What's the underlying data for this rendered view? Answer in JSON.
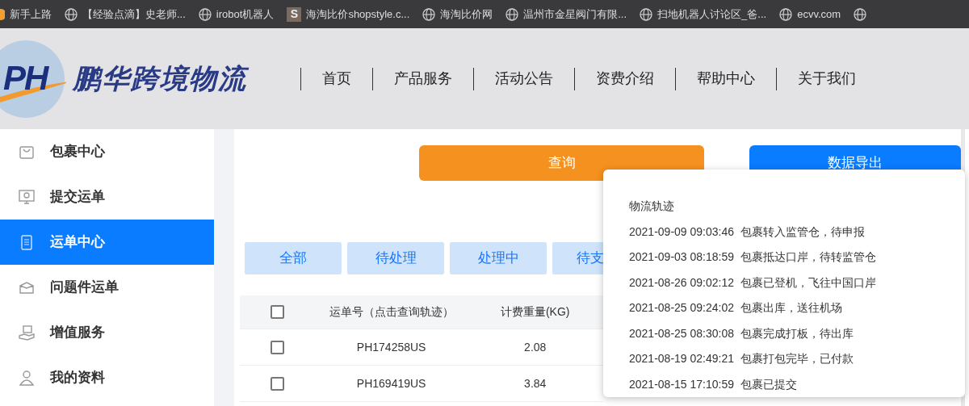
{
  "bookmarks": [
    {
      "kind": "dot",
      "label": "新手上路"
    },
    {
      "kind": "globe",
      "label": "【经验点滴】史老师..."
    },
    {
      "kind": "globe",
      "label": "irobot机器人"
    },
    {
      "kind": "letter",
      "letter": "S",
      "label": "海淘比价shopstyle.c..."
    },
    {
      "kind": "globe",
      "label": "海淘比价网"
    },
    {
      "kind": "globe",
      "label": "温州市金星阀门有限..."
    },
    {
      "kind": "globe",
      "label": "扫地机器人讨论区_爸..."
    },
    {
      "kind": "globe",
      "label": "ecvv.com"
    },
    {
      "kind": "globe"
    }
  ],
  "header": {
    "logo_mark": "PH",
    "logo_text": "鹏华跨境物流",
    "nav": [
      "首页",
      "产品服务",
      "活动公告",
      "资费介绍",
      "帮助中心",
      "关于我们"
    ]
  },
  "sidebar": {
    "items": [
      {
        "kind": "bag",
        "label": "包裹中心",
        "selected": false
      },
      {
        "kind": "monitor",
        "label": "提交运单",
        "selected": false
      },
      {
        "kind": "clipboard",
        "label": "运单中心",
        "selected": true
      },
      {
        "kind": "box",
        "label": "问题件运单",
        "selected": false
      },
      {
        "kind": "hand",
        "label": "增值服务",
        "selected": false
      },
      {
        "kind": "person",
        "label": "我的资料",
        "selected": false
      }
    ]
  },
  "actions": [
    {
      "kind": "query",
      "label": "查询"
    },
    {
      "kind": "export",
      "label": "数据导出"
    }
  ],
  "status_tabs": [
    "全部",
    "待处理",
    "处理中",
    "待支"
  ],
  "table": {
    "columns": [
      "运单号（点击查询轨迹）",
      "计费重量(KG)"
    ],
    "header_checked": false,
    "rows": [
      {
        "checked": false,
        "cells": [
          "PH174258US",
          "2.08"
        ]
      },
      {
        "checked": false,
        "cells": [
          "PH169419US",
          "3.84"
        ]
      }
    ]
  },
  "tracking_popover": {
    "title": "物流轨迹",
    "events": [
      {
        "time": "2021-09-09 09:03:46",
        "text": "包裹转入监管仓，待申报"
      },
      {
        "time": "2021-09-03 08:18:59",
        "text": "包裹抵达口岸，待转监管仓"
      },
      {
        "time": "2021-08-26 09:02:12",
        "text": "包裹已登机，飞往中国口岸"
      },
      {
        "time": "2021-08-25 09:24:02",
        "text": "包裹出库，送往机场"
      },
      {
        "time": "2021-08-25 08:30:08",
        "text": "包裹完成打板，待出库"
      },
      {
        "time": "2021-08-19 02:49:21",
        "text": "包裹打包完毕，已付款"
      },
      {
        "time": "2021-08-15 17:10:59",
        "text": "包裹已提交"
      }
    ]
  }
}
